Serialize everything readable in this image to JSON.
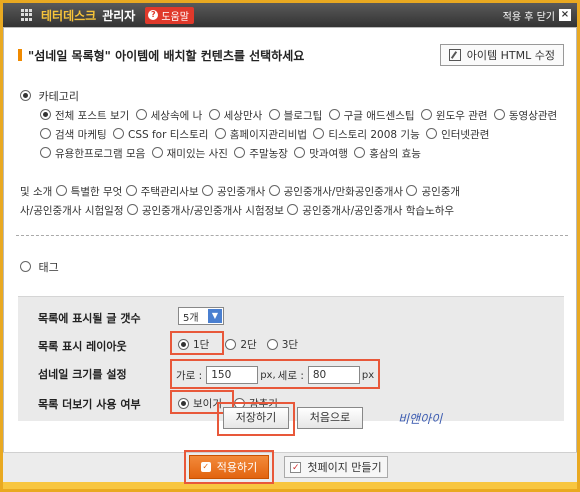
{
  "titlebar": {
    "brand": "테터데스크",
    "admin": "관리자",
    "help": "도움말",
    "help_icon": "question-icon",
    "close_after": "적용 후 닫기",
    "close_icon": "close-icon"
  },
  "header": {
    "title": "\"섬네일 목록형\" 아이템에 배치할 컨텐츠를 선택하세요",
    "html_edit": "아이템 HTML 수정"
  },
  "category": {
    "label": "카테고리",
    "items": [
      "전체 포스트 보기",
      "세상속에 나",
      "세상만사",
      "블로그팁",
      "구글 애드센스팁",
      "윈도우 관련",
      "동영상관련",
      "검색 마케팅",
      "CSS for 티스토리",
      "홈페이지관리비법",
      "티스토리 2008 기능",
      "인터넷관련",
      "유용한프로그램 모음",
      "재미있는 사진",
      "주말농장",
      "맛과여행",
      "홍삼의 효능"
    ],
    "items_cont": [
      "및 소개",
      "특별한 무엇",
      "주택관리사보",
      "공인중개사",
      "공인중개사/만화공인중개사",
      "공인중개",
      "사/공인중개사 시험일정",
      "공인중개사/공인중개사 시험정보",
      "공인중개사/공인중개사 학습노하우"
    ]
  },
  "tag": {
    "label": "태그"
  },
  "settings": {
    "count_label": "목록에 표시될 글 갯수",
    "count_value": "5개",
    "layout_label": "목록 표시 레이아웃",
    "layout_options": [
      "1단",
      "2단",
      "3단"
    ],
    "size_label": "섬네일 크기를 설정",
    "width_label": "가로 :",
    "width_value": "150",
    "height_label": "세로 :",
    "height_value": "80",
    "unit": "px",
    "unit_comma": "px,",
    "more_label": "목록 더보기 사용 여부",
    "more_options": [
      "보이기",
      "감추기"
    ]
  },
  "actions": {
    "save": "저장하기",
    "reset": "처음으로",
    "signature": "비앤아이"
  },
  "footer": {
    "apply": "적용하기",
    "firstpage": "첫페이지 만들기"
  },
  "colors": {
    "brand_yellow": "#f6c43a",
    "highlight": "#e8583a",
    "apply_orange": "#e26410"
  }
}
